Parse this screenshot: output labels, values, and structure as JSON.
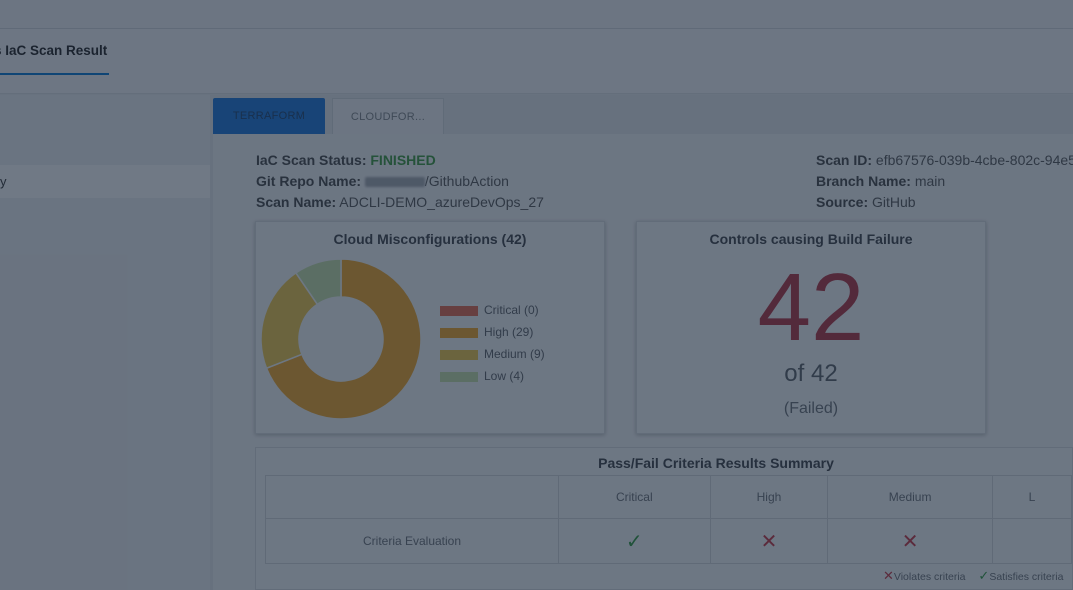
{
  "header": {
    "tab_label": "s IaC Scan Result"
  },
  "sidebar": {
    "item_label": "y"
  },
  "tabs": [
    {
      "label": "TERRAFORM",
      "active": true
    },
    {
      "label": "CLOUDFOR...",
      "active": false
    }
  ],
  "scan_info": {
    "status_label": "IaC Scan Status:",
    "status_value": "FINISHED",
    "repo_label": "Git Repo Name:",
    "repo_value": "/GithubAction",
    "scan_name_label": "Scan Name:",
    "scan_name_value": "ADCLI-DEMO_azureDevOps_27",
    "scan_id_label": "Scan ID:",
    "scan_id_value": "efb67576-039b-4cbe-802c-94e5",
    "branch_label": "Branch Name:",
    "branch_value": "main",
    "source_label": "Source:",
    "source_value": "GitHub"
  },
  "misconfig_card": {
    "title": "Cloud Misconfigurations (42)",
    "legend": [
      {
        "label": "Critical (0)",
        "color": "#e8664a"
      },
      {
        "label": "High (29)",
        "color": "#f5a623"
      },
      {
        "label": "Medium (9)",
        "color": "#f2c744"
      },
      {
        "label": "Low (4)",
        "color": "#c9e3a8"
      }
    ]
  },
  "chart_data": {
    "type": "pie",
    "title": "Cloud Misconfigurations (42)",
    "categories": [
      "Critical",
      "High",
      "Medium",
      "Low"
    ],
    "values": [
      0,
      29,
      9,
      4
    ],
    "colors": [
      "#e8664a",
      "#f5a623",
      "#f2c744",
      "#c9e3a8"
    ],
    "donut": true,
    "legend_position": "right"
  },
  "build_failure_card": {
    "title": "Controls causing Build Failure",
    "count": "42",
    "of_total": "of 42",
    "status": "(Failed)"
  },
  "summary": {
    "title": "Pass/Fail Criteria Results Summary",
    "columns": [
      "",
      "Critical",
      "High",
      "Medium",
      "L"
    ],
    "row_label": "Criteria Evaluation",
    "results": [
      "✓",
      "✕",
      "✕",
      ""
    ],
    "legend_violates": "Violates criteria",
    "legend_satisfies": "Satisfies criteria"
  }
}
